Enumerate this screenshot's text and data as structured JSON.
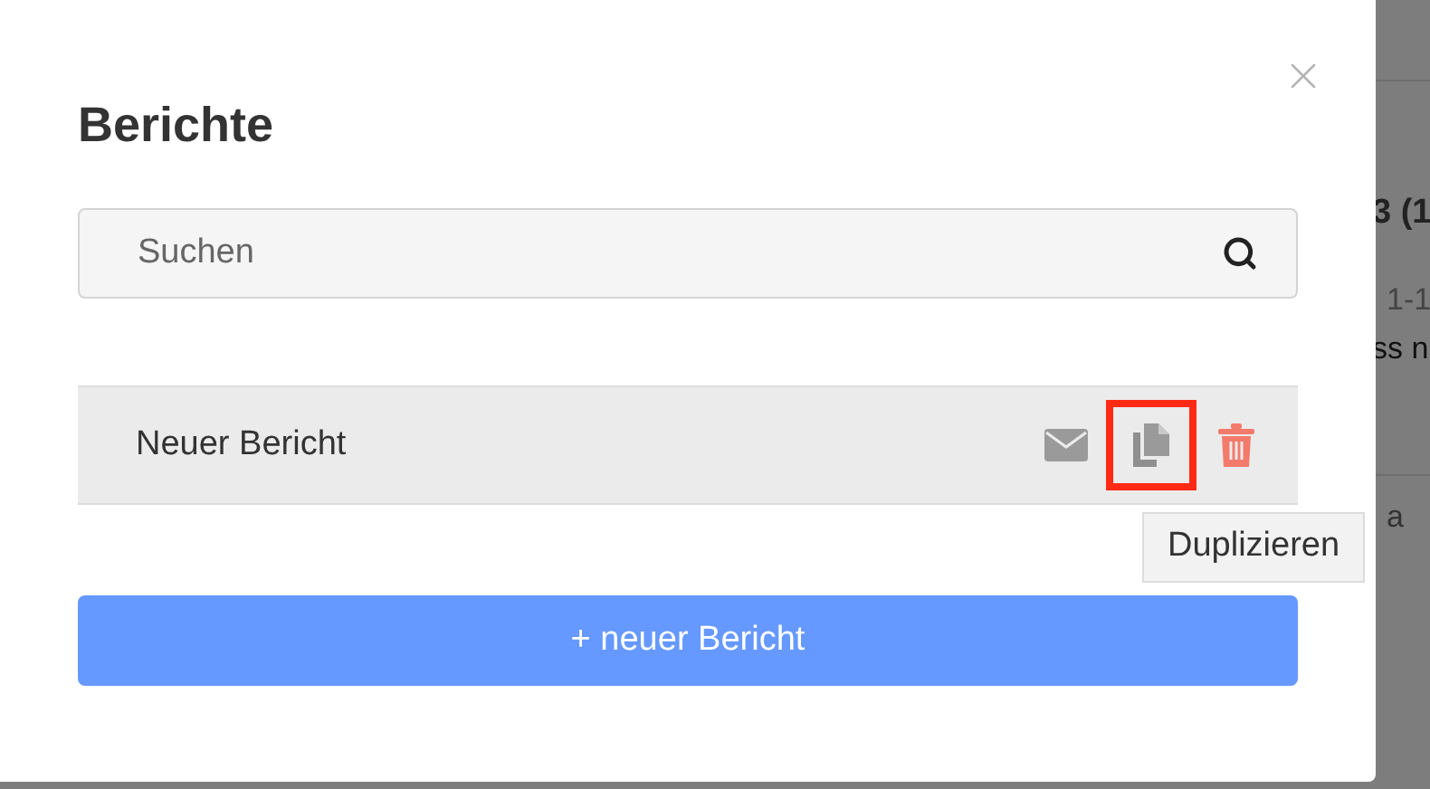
{
  "background": {
    "texts": [
      "3 (1",
      "1-1",
      "ss n",
      "a"
    ]
  },
  "dialog": {
    "title": "Berichte",
    "search": {
      "placeholder": "Suchen"
    },
    "reports": [
      {
        "name": "Neuer Bericht",
        "actions": [
          {
            "kind": "mail",
            "highlighted": false
          },
          {
            "kind": "copy",
            "highlighted": true
          },
          {
            "kind": "delete",
            "highlighted": false
          }
        ]
      }
    ],
    "tooltip": "Duplizieren",
    "new_button": "+ neuer Bericht"
  }
}
